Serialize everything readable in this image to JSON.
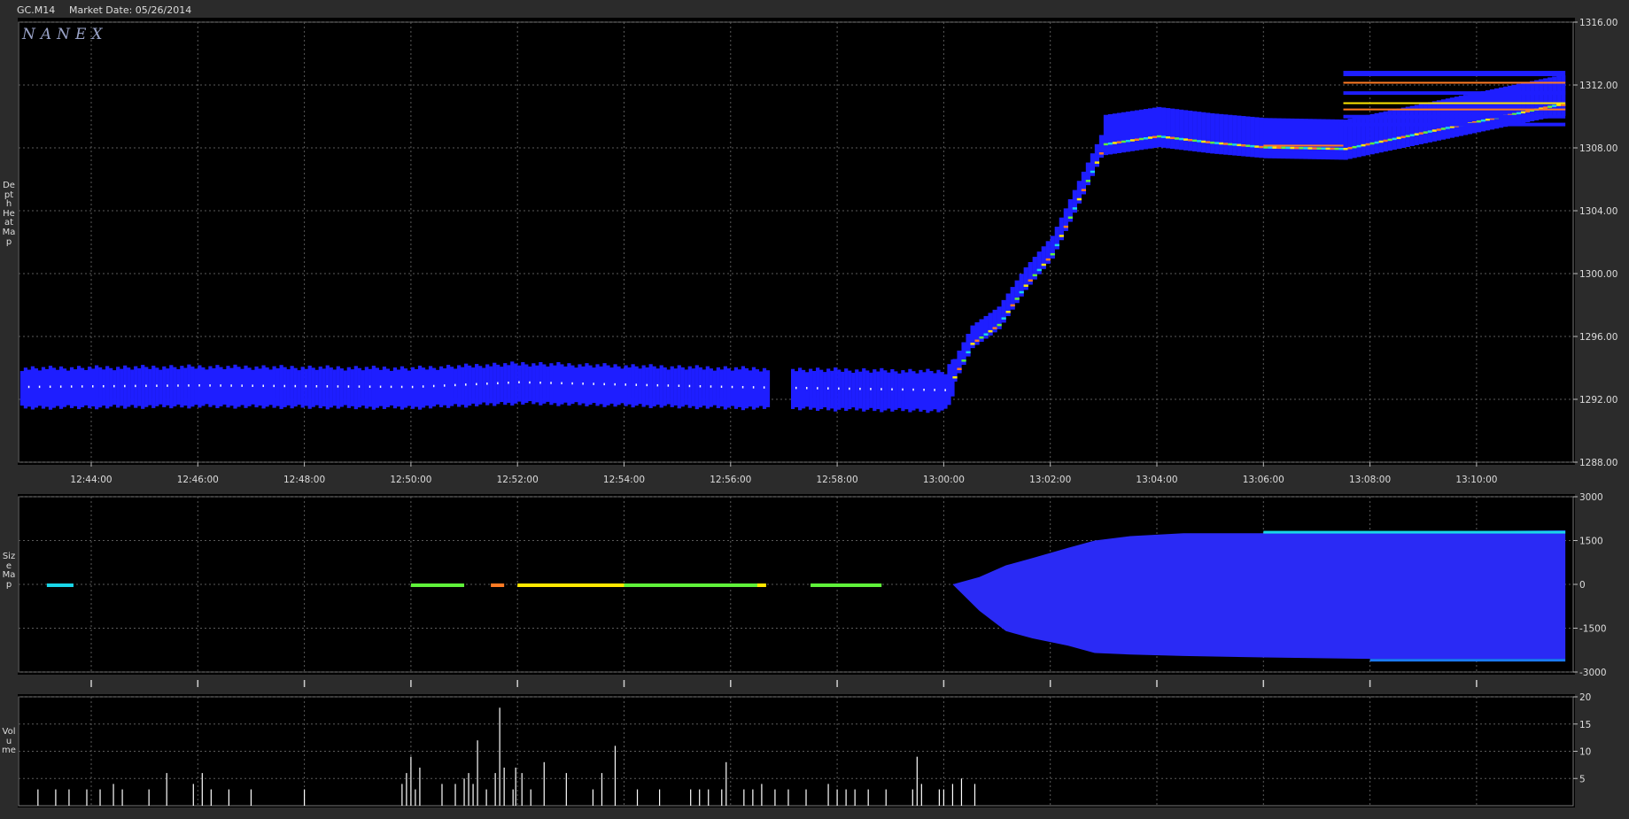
{
  "header": {
    "symbol": "GC.M14",
    "market_date_label": "Market Date: 05/26/2014"
  },
  "logo": "NANEX",
  "panel_labels": {
    "depth": "Depth Heat Map",
    "size": "Size Map",
    "volume": "Volume"
  },
  "colors": {
    "background": "#000000",
    "frame": "#2b2b2b",
    "grid": "#5a5a5a",
    "blue": "#1e1eff",
    "cyan": "#19d6e8",
    "green": "#5ff23a",
    "yellow": "#ffe800",
    "orange": "#ff7b24",
    "volume": "#ffffff"
  },
  "chart_data": [
    {
      "type": "heatmap",
      "title": "Depth Heat Map",
      "x_ticks": [
        "12:44:00",
        "12:46:00",
        "12:48:00",
        "12:50:00",
        "12:52:00",
        "12:54:00",
        "12:56:00",
        "12:58:00",
        "13:00:00",
        "13:02:00",
        "13:04:00",
        "13:06:00",
        "13:08:00",
        "13:10:00"
      ],
      "y_ticks": [
        "1316.00",
        "1312.00",
        "1308.00",
        "1304.00",
        "1300.00",
        "1296.00",
        "1292.00",
        "1288.00"
      ],
      "ylim": [
        1288,
        1316
      ],
      "grid": true,
      "price_path": {
        "times": [
          "12:42:40",
          "12:46:00",
          "12:50:00",
          "12:52:00",
          "12:56:00",
          "13:00:00",
          "13:00:30",
          "13:01:00",
          "13:01:30",
          "13:02:00",
          "13:02:30",
          "13:03:00",
          "13:04:00",
          "13:05:00",
          "13:06:00",
          "13:07:30",
          "13:11:30"
        ],
        "values": [
          1292.8,
          1292.9,
          1292.8,
          1293.1,
          1292.8,
          1292.6,
          1295.8,
          1297.0,
          1299.5,
          1301.5,
          1305.0,
          1308.5,
          1309.0,
          1308.6,
          1308.3,
          1308.2,
          1311.0
        ]
      }
    },
    {
      "type": "area",
      "title": "Size Map",
      "y_ticks": [
        "3000",
        "1500",
        "0",
        "-1500",
        "-3000"
      ],
      "ylim": [
        -3000,
        3000
      ],
      "grid": true,
      "upper": {
        "times": [
          "12:42:40",
          "13:00:10",
          "13:00:40",
          "13:01:10",
          "13:01:40",
          "13:02:20",
          "13:02:50",
          "13:03:30",
          "13:04:30",
          "13:06:00",
          "13:08:00",
          "13:11:40"
        ],
        "values": [
          0,
          0,
          250,
          650,
          900,
          1250,
          1500,
          1650,
          1750,
          1750,
          1800,
          1850
        ]
      },
      "lower": {
        "times": [
          "12:42:40",
          "13:00:10",
          "13:00:40",
          "13:01:10",
          "13:01:40",
          "13:02:20",
          "13:02:50",
          "13:03:30",
          "13:04:30",
          "13:06:00",
          "13:08:00",
          "13:11:40"
        ],
        "values": [
          0,
          0,
          -900,
          -1600,
          -1850,
          -2100,
          -2350,
          -2400,
          -2450,
          -2500,
          -2550,
          -2550
        ]
      }
    },
    {
      "type": "bar",
      "title": "Volume",
      "y_ticks": [
        "20",
        "15",
        "10",
        "5"
      ],
      "ylim": [
        0,
        20
      ],
      "grid": true,
      "bars": [
        {
          "t": "12:43:00",
          "v": 3
        },
        {
          "t": "12:43:20",
          "v": 3
        },
        {
          "t": "12:43:35",
          "v": 3
        },
        {
          "t": "12:43:55",
          "v": 3
        },
        {
          "t": "12:44:10",
          "v": 3
        },
        {
          "t": "12:44:25",
          "v": 4
        },
        {
          "t": "12:44:35",
          "v": 3
        },
        {
          "t": "12:45:05",
          "v": 3
        },
        {
          "t": "12:45:25",
          "v": 6
        },
        {
          "t": "12:45:55",
          "v": 4
        },
        {
          "t": "12:46:05",
          "v": 6
        },
        {
          "t": "12:46:15",
          "v": 3
        },
        {
          "t": "12:46:35",
          "v": 3
        },
        {
          "t": "12:47:00",
          "v": 3
        },
        {
          "t": "12:48:00",
          "v": 3
        },
        {
          "t": "12:49:50",
          "v": 4
        },
        {
          "t": "12:49:55",
          "v": 6
        },
        {
          "t": "12:50:00",
          "v": 9
        },
        {
          "t": "12:50:05",
          "v": 3
        },
        {
          "t": "12:50:10",
          "v": 7
        },
        {
          "t": "12:50:35",
          "v": 4
        },
        {
          "t": "12:50:50",
          "v": 4
        },
        {
          "t": "12:51:00",
          "v": 5
        },
        {
          "t": "12:51:05",
          "v": 6
        },
        {
          "t": "12:51:10",
          "v": 4
        },
        {
          "t": "12:51:15",
          "v": 12
        },
        {
          "t": "12:51:25",
          "v": 3
        },
        {
          "t": "12:51:35",
          "v": 6
        },
        {
          "t": "12:51:40",
          "v": 18
        },
        {
          "t": "12:51:45",
          "v": 7
        },
        {
          "t": "12:51:55",
          "v": 3
        },
        {
          "t": "12:51:58",
          "v": 7
        },
        {
          "t": "12:52:05",
          "v": 6
        },
        {
          "t": "12:52:15",
          "v": 3
        },
        {
          "t": "12:52:30",
          "v": 8
        },
        {
          "t": "12:52:55",
          "v": 6
        },
        {
          "t": "12:53:25",
          "v": 3
        },
        {
          "t": "12:53:35",
          "v": 6
        },
        {
          "t": "12:53:50",
          "v": 11
        },
        {
          "t": "12:54:15",
          "v": 3
        },
        {
          "t": "12:54:40",
          "v": 3
        },
        {
          "t": "12:55:15",
          "v": 3
        },
        {
          "t": "12:55:25",
          "v": 3
        },
        {
          "t": "12:55:35",
          "v": 3
        },
        {
          "t": "12:55:50",
          "v": 3
        },
        {
          "t": "12:55:55",
          "v": 8
        },
        {
          "t": "12:56:15",
          "v": 3
        },
        {
          "t": "12:56:25",
          "v": 3
        },
        {
          "t": "12:56:35",
          "v": 4
        },
        {
          "t": "12:56:50",
          "v": 3
        },
        {
          "t": "12:57:05",
          "v": 3
        },
        {
          "t": "12:57:25",
          "v": 3
        },
        {
          "t": "12:57:50",
          "v": 4
        },
        {
          "t": "12:58:00",
          "v": 3
        },
        {
          "t": "12:58:10",
          "v": 3
        },
        {
          "t": "12:58:20",
          "v": 3
        },
        {
          "t": "12:58:35",
          "v": 3
        },
        {
          "t": "12:58:55",
          "v": 3
        },
        {
          "t": "12:59:25",
          "v": 3
        },
        {
          "t": "12:59:30",
          "v": 9
        },
        {
          "t": "12:59:35",
          "v": 4
        },
        {
          "t": "12:59:55",
          "v": 3
        },
        {
          "t": "13:00:00",
          "v": 3
        },
        {
          "t": "13:00:10",
          "v": 4
        },
        {
          "t": "13:00:20",
          "v": 5
        },
        {
          "t": "13:00:35",
          "v": 4
        }
      ]
    }
  ]
}
